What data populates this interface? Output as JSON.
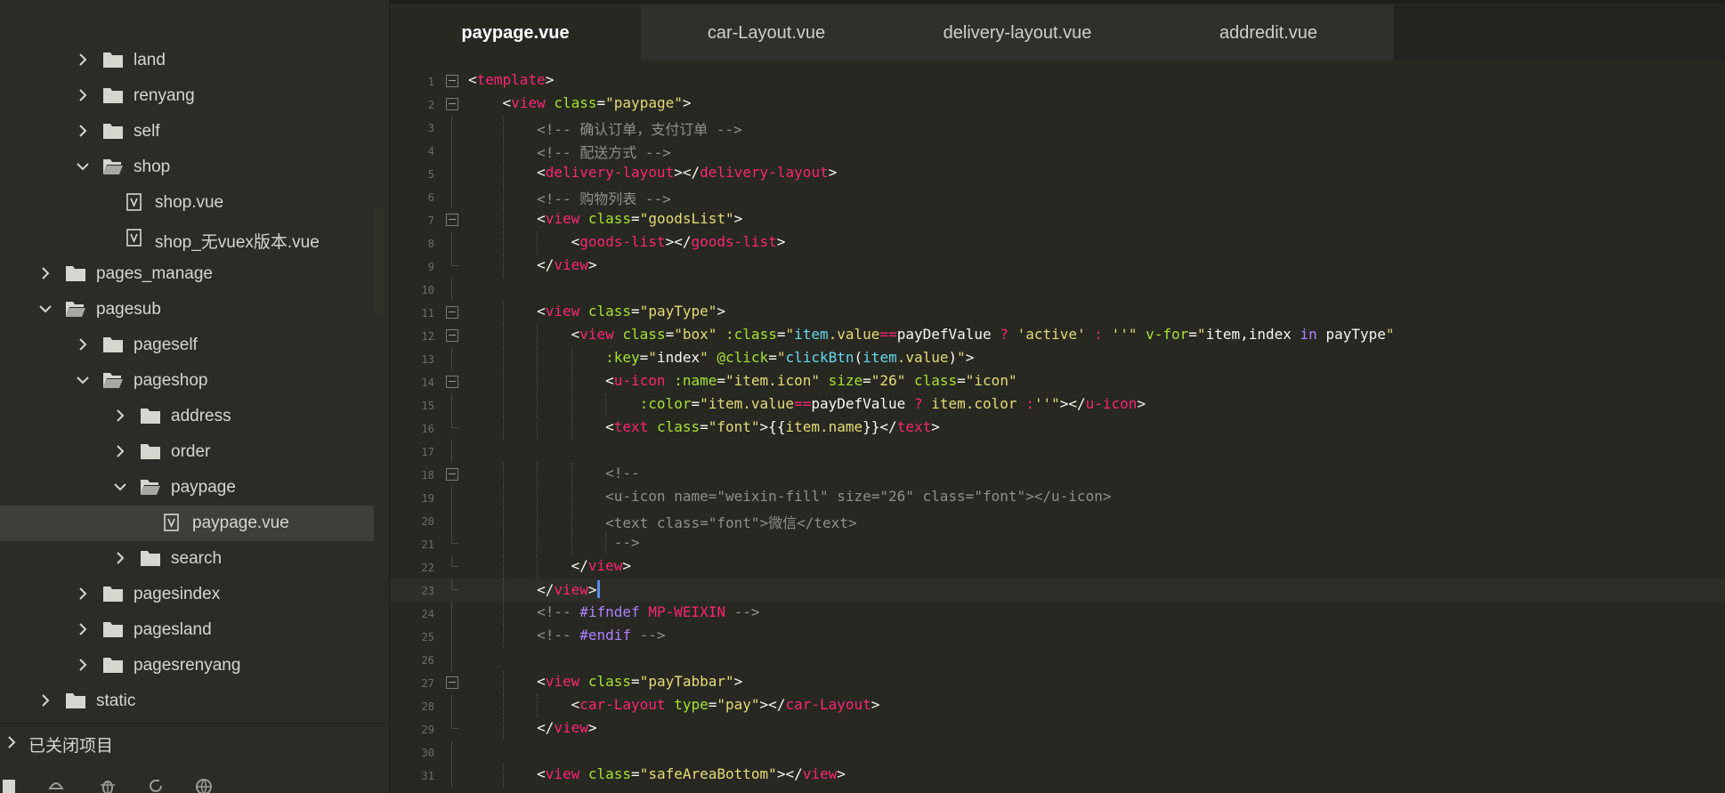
{
  "sidebar": {
    "items": [
      {
        "label": "land",
        "icon": "folder-icon",
        "expanded": false
      },
      {
        "label": "renyang",
        "icon": "folder-icon",
        "expanded": false
      },
      {
        "label": "self",
        "icon": "folder-icon",
        "expanded": false
      },
      {
        "label": "shop",
        "icon": "folder-open-icon",
        "expanded": true
      },
      {
        "label": "shop.vue",
        "icon": "vue-file-icon"
      },
      {
        "label": "shop_无vuex版本.vue",
        "icon": "vue-file-icon"
      },
      {
        "label": "pages_manage",
        "icon": "folder-icon",
        "expanded": false
      },
      {
        "label": "pagesub",
        "icon": "folder-open-icon",
        "expanded": true
      },
      {
        "label": "pageself",
        "icon": "folder-icon",
        "expanded": false
      },
      {
        "label": "pageshop",
        "icon": "folder-open-icon",
        "expanded": true
      },
      {
        "label": "address",
        "icon": "folder-icon",
        "expanded": false
      },
      {
        "label": "order",
        "icon": "folder-icon",
        "expanded": false
      },
      {
        "label": "paypage",
        "icon": "folder-open-icon",
        "expanded": true
      },
      {
        "label": "paypage.vue",
        "icon": "vue-file-icon",
        "selected": true
      },
      {
        "label": "search",
        "icon": "folder-icon",
        "expanded": false
      },
      {
        "label": "pagesindex",
        "icon": "folder-icon",
        "expanded": false
      },
      {
        "label": "pagesland",
        "icon": "folder-icon",
        "expanded": false
      },
      {
        "label": "pagesrenyang",
        "icon": "folder-icon",
        "expanded": false
      },
      {
        "label": "static",
        "icon": "folder-icon",
        "expanded": false
      }
    ],
    "closed_projects_label": "已关闭项目",
    "bottom_icons": [
      "files-icon",
      "android-icon",
      "bug-icon",
      "refresh-icon",
      "globe-icon"
    ]
  },
  "tabs": [
    {
      "label": "paypage.vue",
      "active": true
    },
    {
      "label": "car-Layout.vue",
      "active": false
    },
    {
      "label": "delivery-layout.vue",
      "active": false
    },
    {
      "label": "addredit.vue",
      "active": false
    }
  ],
  "editor": {
    "current_line": 23,
    "lines": [
      {
        "n": "1",
        "fold": "open",
        "tokens": [
          [
            "t-p",
            "<"
          ],
          [
            "t-tag",
            "template"
          ],
          [
            "t-p",
            ">"
          ]
        ]
      },
      {
        "n": "2",
        "fold": "open",
        "tokens": [
          [
            "t-p",
            "    <"
          ],
          [
            "t-tag",
            "view"
          ],
          [
            "t-p",
            " "
          ],
          [
            "t-attr",
            "class"
          ],
          [
            "t-p",
            "="
          ],
          [
            "t-str",
            "\"paypage\""
          ],
          [
            "t-p",
            ">"
          ]
        ]
      },
      {
        "n": "3",
        "tokens": [
          [
            "t-cm",
            "        <!-- 确认订单，支付订单 -->"
          ]
        ]
      },
      {
        "n": "4",
        "tokens": [
          [
            "t-cm",
            "        <!-- 配送方式 -->"
          ]
        ]
      },
      {
        "n": "5",
        "tokens": [
          [
            "t-p",
            "        <"
          ],
          [
            "t-tag",
            "delivery-layout"
          ],
          [
            "t-p",
            "></"
          ],
          [
            "t-tag",
            "delivery-layout"
          ],
          [
            "t-p",
            ">"
          ]
        ]
      },
      {
        "n": "6",
        "tokens": [
          [
            "t-cm",
            "        <!-- 购物列表 -->"
          ]
        ]
      },
      {
        "n": "7",
        "fold": "open",
        "tokens": [
          [
            "t-p",
            "        <"
          ],
          [
            "t-tag",
            "view"
          ],
          [
            "t-p",
            " "
          ],
          [
            "t-attr",
            "class"
          ],
          [
            "t-p",
            "="
          ],
          [
            "t-str",
            "\"goodsList\""
          ],
          [
            "t-p",
            ">"
          ]
        ]
      },
      {
        "n": "8",
        "tokens": [
          [
            "t-p",
            "            <"
          ],
          [
            "t-tag",
            "goods-list"
          ],
          [
            "t-p",
            "></"
          ],
          [
            "t-tag",
            "goods-list"
          ],
          [
            "t-p",
            ">"
          ]
        ]
      },
      {
        "n": "9",
        "fold": "end",
        "tokens": [
          [
            "t-p",
            "        </"
          ],
          [
            "t-tag",
            "view"
          ],
          [
            "t-p",
            ">"
          ]
        ]
      },
      {
        "n": "10",
        "tokens": []
      },
      {
        "n": "11",
        "fold": "open",
        "tokens": [
          [
            "t-p",
            "        <"
          ],
          [
            "t-tag",
            "view"
          ],
          [
            "t-p",
            " "
          ],
          [
            "t-attr",
            "class"
          ],
          [
            "t-p",
            "="
          ],
          [
            "t-str",
            "\"payType\""
          ],
          [
            "t-p",
            ">"
          ]
        ]
      },
      {
        "n": "12",
        "fold": "open",
        "tokens": [
          [
            "t-p",
            "            <"
          ],
          [
            "t-tag",
            "view"
          ],
          [
            "t-p",
            " "
          ],
          [
            "t-attr",
            "class"
          ],
          [
            "t-p",
            "="
          ],
          [
            "t-str",
            "\"box\""
          ],
          [
            "t-p",
            " "
          ],
          [
            "t-attr",
            ":class"
          ],
          [
            "t-p",
            "="
          ],
          [
            "t-str",
            "\""
          ],
          [
            "t-key",
            "item"
          ],
          [
            "t-str",
            ".value"
          ],
          [
            "t-op",
            "=="
          ],
          [
            "t-plain",
            "payDefValue"
          ],
          [
            "t-p",
            " "
          ],
          [
            "t-op",
            "?"
          ],
          [
            "t-p",
            " "
          ],
          [
            "t-str",
            "'active'"
          ],
          [
            "t-p",
            " "
          ],
          [
            "t-op",
            ":"
          ],
          [
            "t-p",
            " "
          ],
          [
            "t-str",
            "''\""
          ],
          [
            "t-p",
            " "
          ],
          [
            "t-attr",
            "v-for"
          ],
          [
            "t-p",
            "="
          ],
          [
            "t-str",
            "\""
          ],
          [
            "t-plain",
            "item,index"
          ],
          [
            "t-p",
            " "
          ],
          [
            "t-kw",
            "in"
          ],
          [
            "t-p",
            " "
          ],
          [
            "t-plain",
            "payType"
          ],
          [
            "t-str",
            "\""
          ]
        ]
      },
      {
        "n": "13",
        "tokens": [
          [
            "t-p",
            "                "
          ],
          [
            "t-attr",
            ":key"
          ],
          [
            "t-p",
            "="
          ],
          [
            "t-str",
            "\""
          ],
          [
            "t-plain",
            "index"
          ],
          [
            "t-str",
            "\""
          ],
          [
            "t-p",
            " "
          ],
          [
            "t-attr",
            "@click"
          ],
          [
            "t-p",
            "="
          ],
          [
            "t-str",
            "\""
          ],
          [
            "t-key",
            "clickBtn"
          ],
          [
            "t-p",
            "("
          ],
          [
            "t-key",
            "item"
          ],
          [
            "t-str",
            ".value"
          ],
          [
            "t-p",
            ")"
          ],
          [
            "t-str",
            "\""
          ],
          [
            "t-p",
            ">"
          ]
        ]
      },
      {
        "n": "14",
        "fold": "open",
        "tokens": [
          [
            "t-p",
            "                <"
          ],
          [
            "t-tag",
            "u-icon"
          ],
          [
            "t-p",
            " "
          ],
          [
            "t-attr",
            ":name"
          ],
          [
            "t-p",
            "="
          ],
          [
            "t-str",
            "\"item.icon\""
          ],
          [
            "t-p",
            " "
          ],
          [
            "t-attr",
            "size"
          ],
          [
            "t-p",
            "="
          ],
          [
            "t-str",
            "\"26\""
          ],
          [
            "t-p",
            " "
          ],
          [
            "t-attr",
            "class"
          ],
          [
            "t-p",
            "="
          ],
          [
            "t-str",
            "\"icon\""
          ]
        ]
      },
      {
        "n": "15",
        "tokens": [
          [
            "t-p",
            "                    "
          ],
          [
            "t-attr",
            ":color"
          ],
          [
            "t-p",
            "="
          ],
          [
            "t-str",
            "\"item.value"
          ],
          [
            "t-op",
            "=="
          ],
          [
            "t-plain",
            "payDefValue"
          ],
          [
            "t-p",
            " "
          ],
          [
            "t-op",
            "?"
          ],
          [
            "t-p",
            " "
          ],
          [
            "t-str",
            "item.color"
          ],
          [
            "t-p",
            " "
          ],
          [
            "t-op",
            ":"
          ],
          [
            "t-str",
            "''\""
          ],
          [
            "t-p",
            "></"
          ],
          [
            "t-tag",
            "u-icon"
          ],
          [
            "t-p",
            ">"
          ]
        ]
      },
      {
        "n": "16",
        "fold": "end",
        "tokens": [
          [
            "t-p",
            "                <"
          ],
          [
            "t-tag",
            "text"
          ],
          [
            "t-p",
            " "
          ],
          [
            "t-attr",
            "class"
          ],
          [
            "t-p",
            "="
          ],
          [
            "t-str",
            "\"font\""
          ],
          [
            "t-p",
            ">{{"
          ],
          [
            "t-str",
            "item.name"
          ],
          [
            "t-p",
            "}}</"
          ],
          [
            "t-tag",
            "text"
          ],
          [
            "t-p",
            ">"
          ]
        ]
      },
      {
        "n": "17",
        "tokens": []
      },
      {
        "n": "18",
        "fold": "open",
        "tokens": [
          [
            "t-cm",
            "                <!--"
          ]
        ]
      },
      {
        "n": "19",
        "tokens": [
          [
            "t-cm",
            "                <u-icon name=\"weixin-fill\" size=\"26\" class=\"font\"></u-icon>"
          ]
        ]
      },
      {
        "n": "20",
        "tokens": [
          [
            "t-cm",
            "                <text class=\"font\">微信</text>"
          ]
        ]
      },
      {
        "n": "21",
        "fold": "end",
        "tokens": [
          [
            "t-cm",
            "                 -->"
          ]
        ]
      },
      {
        "n": "22",
        "fold": "end",
        "tokens": [
          [
            "t-p",
            "            </"
          ],
          [
            "t-tag",
            "view"
          ],
          [
            "t-p",
            ">"
          ]
        ]
      },
      {
        "n": "23",
        "fold": "end",
        "tokens": [
          [
            "t-p",
            "        </"
          ],
          [
            "t-tag",
            "view"
          ],
          [
            "t-p",
            ">"
          ]
        ]
      },
      {
        "n": "24",
        "tokens": [
          [
            "t-cm",
            "        <!-- "
          ],
          [
            "t-kw",
            "#ifndef"
          ],
          [
            "t-cm",
            " "
          ],
          [
            "t-op",
            "MP-WEIXIN"
          ],
          [
            "t-cm",
            " -->"
          ]
        ]
      },
      {
        "n": "25",
        "tokens": [
          [
            "t-cm",
            "        <!-- "
          ],
          [
            "t-kw",
            "#endif"
          ],
          [
            "t-cm",
            " -->"
          ]
        ]
      },
      {
        "n": "26",
        "tokens": []
      },
      {
        "n": "27",
        "fold": "open",
        "tokens": [
          [
            "t-p",
            "        <"
          ],
          [
            "t-tag",
            "view"
          ],
          [
            "t-p",
            " "
          ],
          [
            "t-attr",
            "class"
          ],
          [
            "t-p",
            "="
          ],
          [
            "t-str",
            "\"payTabbar\""
          ],
          [
            "t-p",
            ">"
          ]
        ]
      },
      {
        "n": "28",
        "tokens": [
          [
            "t-p",
            "            <"
          ],
          [
            "t-tag",
            "car-Layout"
          ],
          [
            "t-p",
            " "
          ],
          [
            "t-attr",
            "type"
          ],
          [
            "t-p",
            "="
          ],
          [
            "t-str",
            "\"pay\""
          ],
          [
            "t-p",
            "></"
          ],
          [
            "t-tag",
            "car-Layout"
          ],
          [
            "t-p",
            ">"
          ]
        ]
      },
      {
        "n": "29",
        "fold": "end",
        "tokens": [
          [
            "t-p",
            "        </"
          ],
          [
            "t-tag",
            "view"
          ],
          [
            "t-p",
            ">"
          ]
        ]
      },
      {
        "n": "30",
        "tokens": []
      },
      {
        "n": "31",
        "tokens": [
          [
            "t-p",
            "        <"
          ],
          [
            "t-tag",
            "view"
          ],
          [
            "t-p",
            " "
          ],
          [
            "t-attr",
            "class"
          ],
          [
            "t-p",
            "="
          ],
          [
            "t-str",
            "\"safeAreaBottom\""
          ],
          [
            "t-p",
            "></"
          ],
          [
            "t-tag",
            "view"
          ],
          [
            "t-p",
            ">"
          ]
        ]
      }
    ]
  }
}
